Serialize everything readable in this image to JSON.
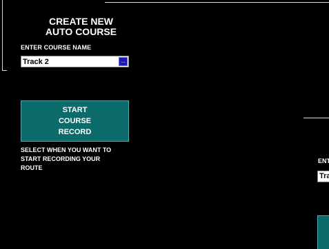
{
  "screen": {
    "title": "CREATE NEW\nAUTO COURSE",
    "course_name_label": "ENTER COURSE NAME",
    "course_name_value": "Track 2",
    "browse_button_label": "...",
    "start_button_label": "START\nCOURSE\nRECORD",
    "hint_text": "SELECT WHEN YOU WANT TO\nSTART RECORDING YOUR\nROUTE"
  },
  "background_panel": {
    "label_fragment": "ENT",
    "field_fragment": "Tra"
  },
  "colors": {
    "background": "#000000",
    "text": "#ffffff",
    "button_fill": "#0b6b6b",
    "button_border": "#55a8a8",
    "browse_button": "#1a1ab8"
  }
}
